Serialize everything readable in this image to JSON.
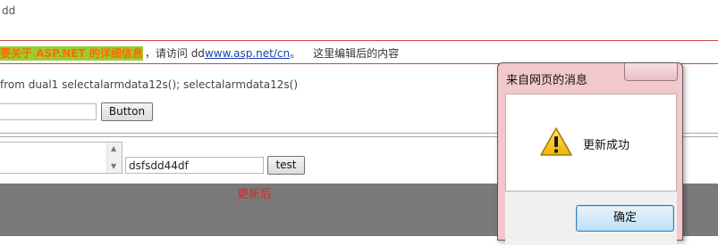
{
  "top_text": "dd",
  "info": {
    "highlight": "要关于 ASP.NET 的详细信息",
    "mid": "，请访问 dd",
    "link": "www.asp.net/cn",
    "period": "。",
    "tail": "这里编辑后的内容"
  },
  "sql_text": "from dual1 selectalarmdata12s(); selectalarmdata12s()",
  "form1": {
    "input_value": "",
    "button_label": "Button"
  },
  "form2": {
    "input_value": "dsfsdd44df",
    "button_label": "test"
  },
  "status_text": "更新后",
  "dialog": {
    "title": "来自网页的消息",
    "message": "更新成功",
    "ok_label": "确定",
    "icon": "warning-icon"
  },
  "colors": {
    "highlight_bg": "#9acd32",
    "highlight_text": "#ff6a00",
    "link": "#1a3fb5",
    "status": "#d12a2a",
    "overlay": "#7a7a7a",
    "dialog_frame": "#f2c8cc"
  }
}
